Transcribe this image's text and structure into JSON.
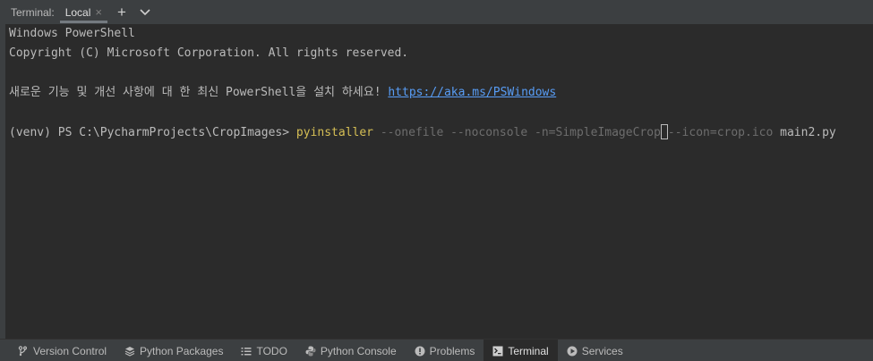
{
  "header": {
    "title": "Terminal:",
    "tab_label": "Local",
    "tab_close": "×",
    "add_glyph": "+",
    "dropdown_glyph": "⌄"
  },
  "terminal": {
    "line1": "Windows PowerShell",
    "line2": "Copyright (C) Microsoft Corporation. All rights reserved.",
    "line3_text": "새로운 기능 및 개선 사항에 대 한 최신 PowerShell을 설치 하세요! ",
    "line3_link": "https://aka.ms/PSWindows",
    "prompt": "(venv) PS C:\\PycharmProjects\\CropImages> ",
    "command": "pyinstaller",
    "args1": " --onefile --noconsole -n=SimpleImageCrop",
    "args2": "--icon=crop.ico",
    "file": " main2.py"
  },
  "bottombar": {
    "items": [
      {
        "label": "Version Control",
        "icon": "branch-icon"
      },
      {
        "label": "Python Packages",
        "icon": "layers-icon"
      },
      {
        "label": "TODO",
        "icon": "list-icon"
      },
      {
        "label": "Python Console",
        "icon": "python-icon"
      },
      {
        "label": "Problems",
        "icon": "info-icon"
      },
      {
        "label": "Terminal",
        "icon": "terminal-icon"
      },
      {
        "label": "Services",
        "icon": "play-icon"
      }
    ]
  },
  "colors": {
    "background": "#2b2b2b",
    "panel": "#3c3f41",
    "text": "#bbbbbb",
    "command": "#d6bf55",
    "link": "#589df6",
    "argument": "#6d6d6d"
  }
}
